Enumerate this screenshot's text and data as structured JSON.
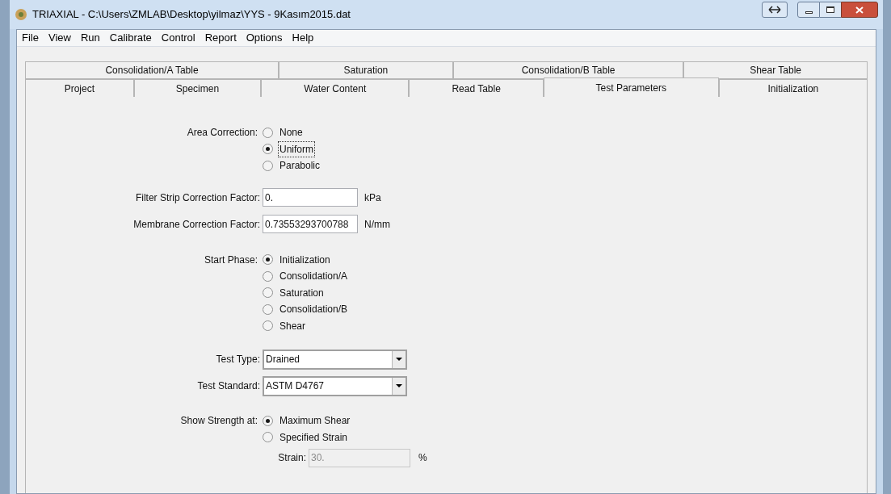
{
  "window": {
    "title": "TRIAXIAL - C:\\Users\\ZMLAB\\Desktop\\yilmaz\\YYS - 9Kasım2015.dat"
  },
  "menu": [
    "File",
    "View",
    "Run",
    "Calibrate",
    "Control",
    "Report",
    "Options",
    "Help"
  ],
  "tabs_back": [
    {
      "label": "Consolidation/A Table",
      "selected": false
    },
    {
      "label": "Saturation",
      "selected": false
    },
    {
      "label": "Consolidation/B Table",
      "selected": false
    },
    {
      "label": "Shear Table",
      "selected": false
    }
  ],
  "tabs_front": [
    {
      "label": "Project",
      "selected": false
    },
    {
      "label": "Specimen",
      "selected": false
    },
    {
      "label": "Water Content",
      "selected": false
    },
    {
      "label": "Read Table",
      "selected": false
    },
    {
      "label": "Test Parameters",
      "selected": true
    },
    {
      "label": "Initialization",
      "selected": false
    }
  ],
  "area_correction": {
    "label": "Area Correction:",
    "options": [
      {
        "label": "None",
        "selected": false
      },
      {
        "label": "Uniform",
        "selected": true
      },
      {
        "label": "Parabolic",
        "selected": false
      }
    ]
  },
  "filter_strip": {
    "label": "Filter Strip Correction Factor:",
    "value": "0.",
    "unit": "kPa"
  },
  "membrane": {
    "label": "Membrane Correction Factor:",
    "value": "0.73553293700788",
    "unit": "N/mm"
  },
  "start_phase": {
    "label": "Start Phase:",
    "options": [
      {
        "label": "Initialization",
        "selected": true
      },
      {
        "label": "Consolidation/A",
        "selected": false
      },
      {
        "label": "Saturation",
        "selected": false
      },
      {
        "label": "Consolidation/B",
        "selected": false
      },
      {
        "label": "Shear",
        "selected": false
      }
    ]
  },
  "test_type": {
    "label": "Test Type:",
    "value": "Drained"
  },
  "test_standard": {
    "label": "Test Standard:",
    "value": "ASTM D4767"
  },
  "show_strength": {
    "label": "Show Strength at:",
    "options": [
      {
        "label": "Maximum Shear",
        "selected": true
      },
      {
        "label": "Specified Strain",
        "selected": false
      }
    ]
  },
  "strain": {
    "label": "Strain:",
    "value": "30.",
    "unit": "%",
    "disabled": true
  }
}
